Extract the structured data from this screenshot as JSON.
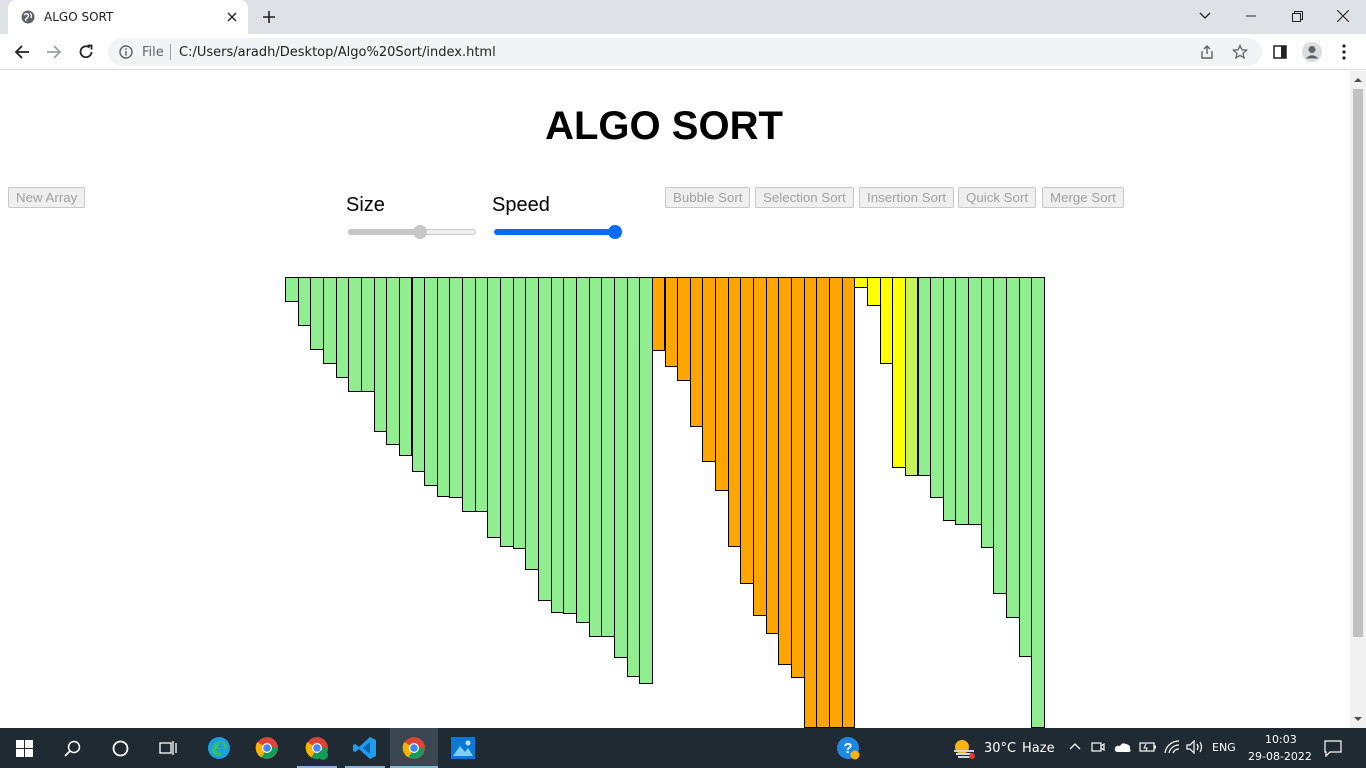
{
  "browser": {
    "tab_title": "ALGO SORT",
    "file_label": "File",
    "url": "C:/Users/aradh/Desktop/Algo%20Sort/index.html"
  },
  "page": {
    "title": "ALGO SORT",
    "new_array_label": "New Array",
    "size_label": "Size",
    "speed_label": "Speed",
    "size_value": 0.57,
    "speed_value": 1.0,
    "sort_buttons": [
      "Bubble Sort",
      "Selection Sort",
      "Insertion Sort",
      "Quick Sort",
      "Merge Sort"
    ],
    "colors": {
      "sorted": "#90ee90",
      "pivot": "#ffa500",
      "compare": "#ffff00",
      "mixed": "#c8f25a",
      "accent": "#0a6cf3"
    }
  },
  "bars": {
    "values": [
      25,
      49,
      73,
      87,
      101,
      115,
      115,
      155,
      168,
      179,
      195,
      209,
      220,
      221,
      235,
      235,
      261,
      270,
      272,
      293,
      324,
      336,
      337,
      346,
      360,
      360,
      381,
      400,
      407,
      74,
      90,
      104,
      150,
      185,
      214,
      270,
      307,
      339,
      357,
      388,
      401,
      451,
      451,
      451,
      451,
      11,
      29,
      87,
      191,
      199,
      199,
      221,
      244,
      248,
      248,
      271,
      317,
      341,
      380,
      451
    ],
    "states": [
      "s",
      "s",
      "s",
      "s",
      "s",
      "s",
      "s",
      "s",
      "s",
      "s",
      "s",
      "s",
      "s",
      "s",
      "s",
      "s",
      "s",
      "s",
      "s",
      "s",
      "s",
      "s",
      "s",
      "s",
      "s",
      "s",
      "s",
      "s",
      "s",
      "p",
      "p",
      "p",
      "p",
      "p",
      "p",
      "p",
      "p",
      "p",
      "p",
      "p",
      "p",
      "p",
      "p",
      "p",
      "p",
      "c",
      "c",
      "c",
      "c",
      "m",
      "s",
      "s",
      "s",
      "s",
      "s",
      "s",
      "s",
      "s",
      "s",
      "s"
    ]
  },
  "taskbar": {
    "weather_temp": "30°C",
    "weather_desc": "Haze",
    "language": "ENG",
    "time": "10:03",
    "date": "29-08-2022"
  }
}
